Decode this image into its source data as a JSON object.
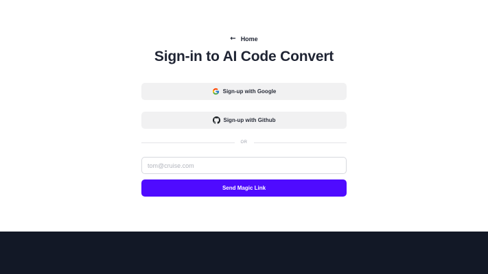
{
  "nav": {
    "home_label": "Home",
    "home_icon": "arrow-left-icon"
  },
  "header": {
    "title": "Sign-in to AI Code Convert"
  },
  "auth": {
    "google_label": "Sign-up with Google",
    "google_icon": "google-icon",
    "github_label": "Sign-up with Github",
    "github_icon": "github-icon",
    "divider_label": "OR",
    "email_placeholder": "tom@cruise.com",
    "email_value": "",
    "submit_label": "Send Magic Link"
  },
  "colors": {
    "primary_button": "#4f0bff",
    "oauth_button_bg": "#f1f1f2",
    "footer_bg": "#121826",
    "text_dark": "#1f2433"
  }
}
